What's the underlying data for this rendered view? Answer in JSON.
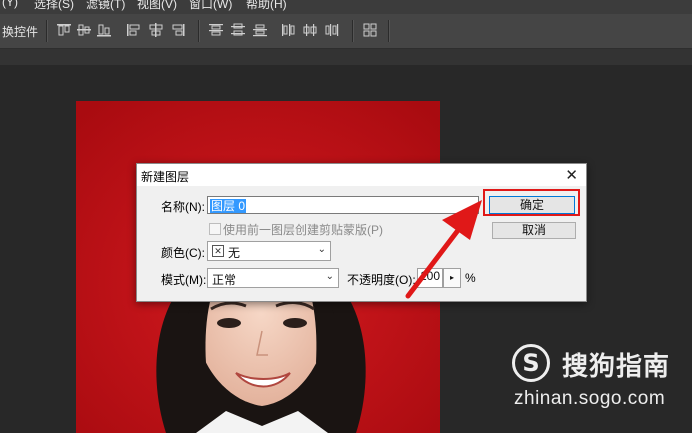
{
  "menubar": {
    "items": [
      "(Y)",
      "选择(S)",
      "滤镜(T)",
      "视图(V)",
      "窗口(W)",
      "帮助(H)"
    ]
  },
  "optionsbar": {
    "label": "换控件"
  },
  "dialog": {
    "title": "新建图层",
    "close_glyph": "✕",
    "name_label": "名称(N):",
    "name_value": "图层 0",
    "clip_checkbox_label": "使用前一图层创建剪贴蒙版(P)",
    "clip_checked": false,
    "color_label": "颜色(C):",
    "color_value": "无",
    "color_swatch_glyph": "✕",
    "mode_label": "模式(M):",
    "mode_value": "正常",
    "opacity_label": "不透明度(O):",
    "opacity_value": "100",
    "opacity_unit": "%",
    "ok_label": "确定",
    "cancel_label": "取消"
  },
  "watermark": {
    "logo_glyph": "S",
    "text": "搜狗指南",
    "url": "zhinan.sogo.com"
  },
  "colors": {
    "photo_background": "#c21016",
    "highlight": "#e01818"
  }
}
